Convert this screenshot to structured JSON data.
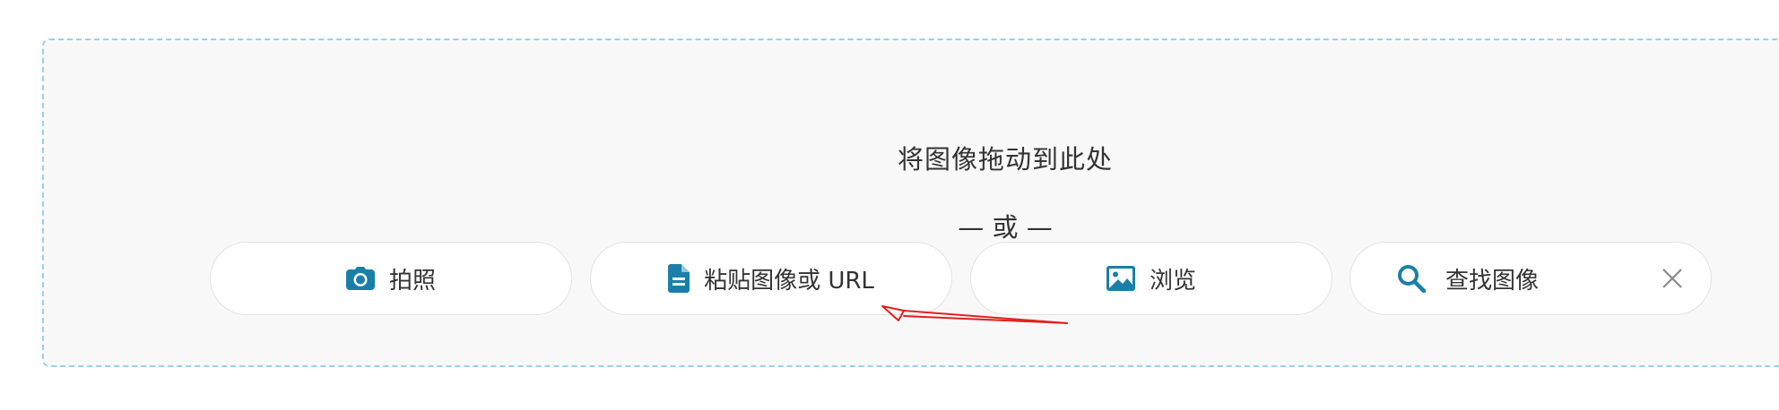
{
  "dropzone": {
    "drag_text": "将图像拖动到此处",
    "or_text": "— 或 —"
  },
  "buttons": {
    "camera_label": "拍照",
    "paste_label": "粘贴图像或 URL",
    "browse_label": "浏览",
    "search_label": "查找图像"
  },
  "icons": {
    "camera": "camera-icon",
    "paste": "document-icon",
    "browse": "image-icon",
    "search": "search-icon",
    "close": "close-icon"
  },
  "colors": {
    "accent": "#1a7fa8",
    "dropzone_border": "#9ad2e6",
    "dropzone_bg": "#f8f8f8",
    "annotation_arrow": "#e02020"
  }
}
